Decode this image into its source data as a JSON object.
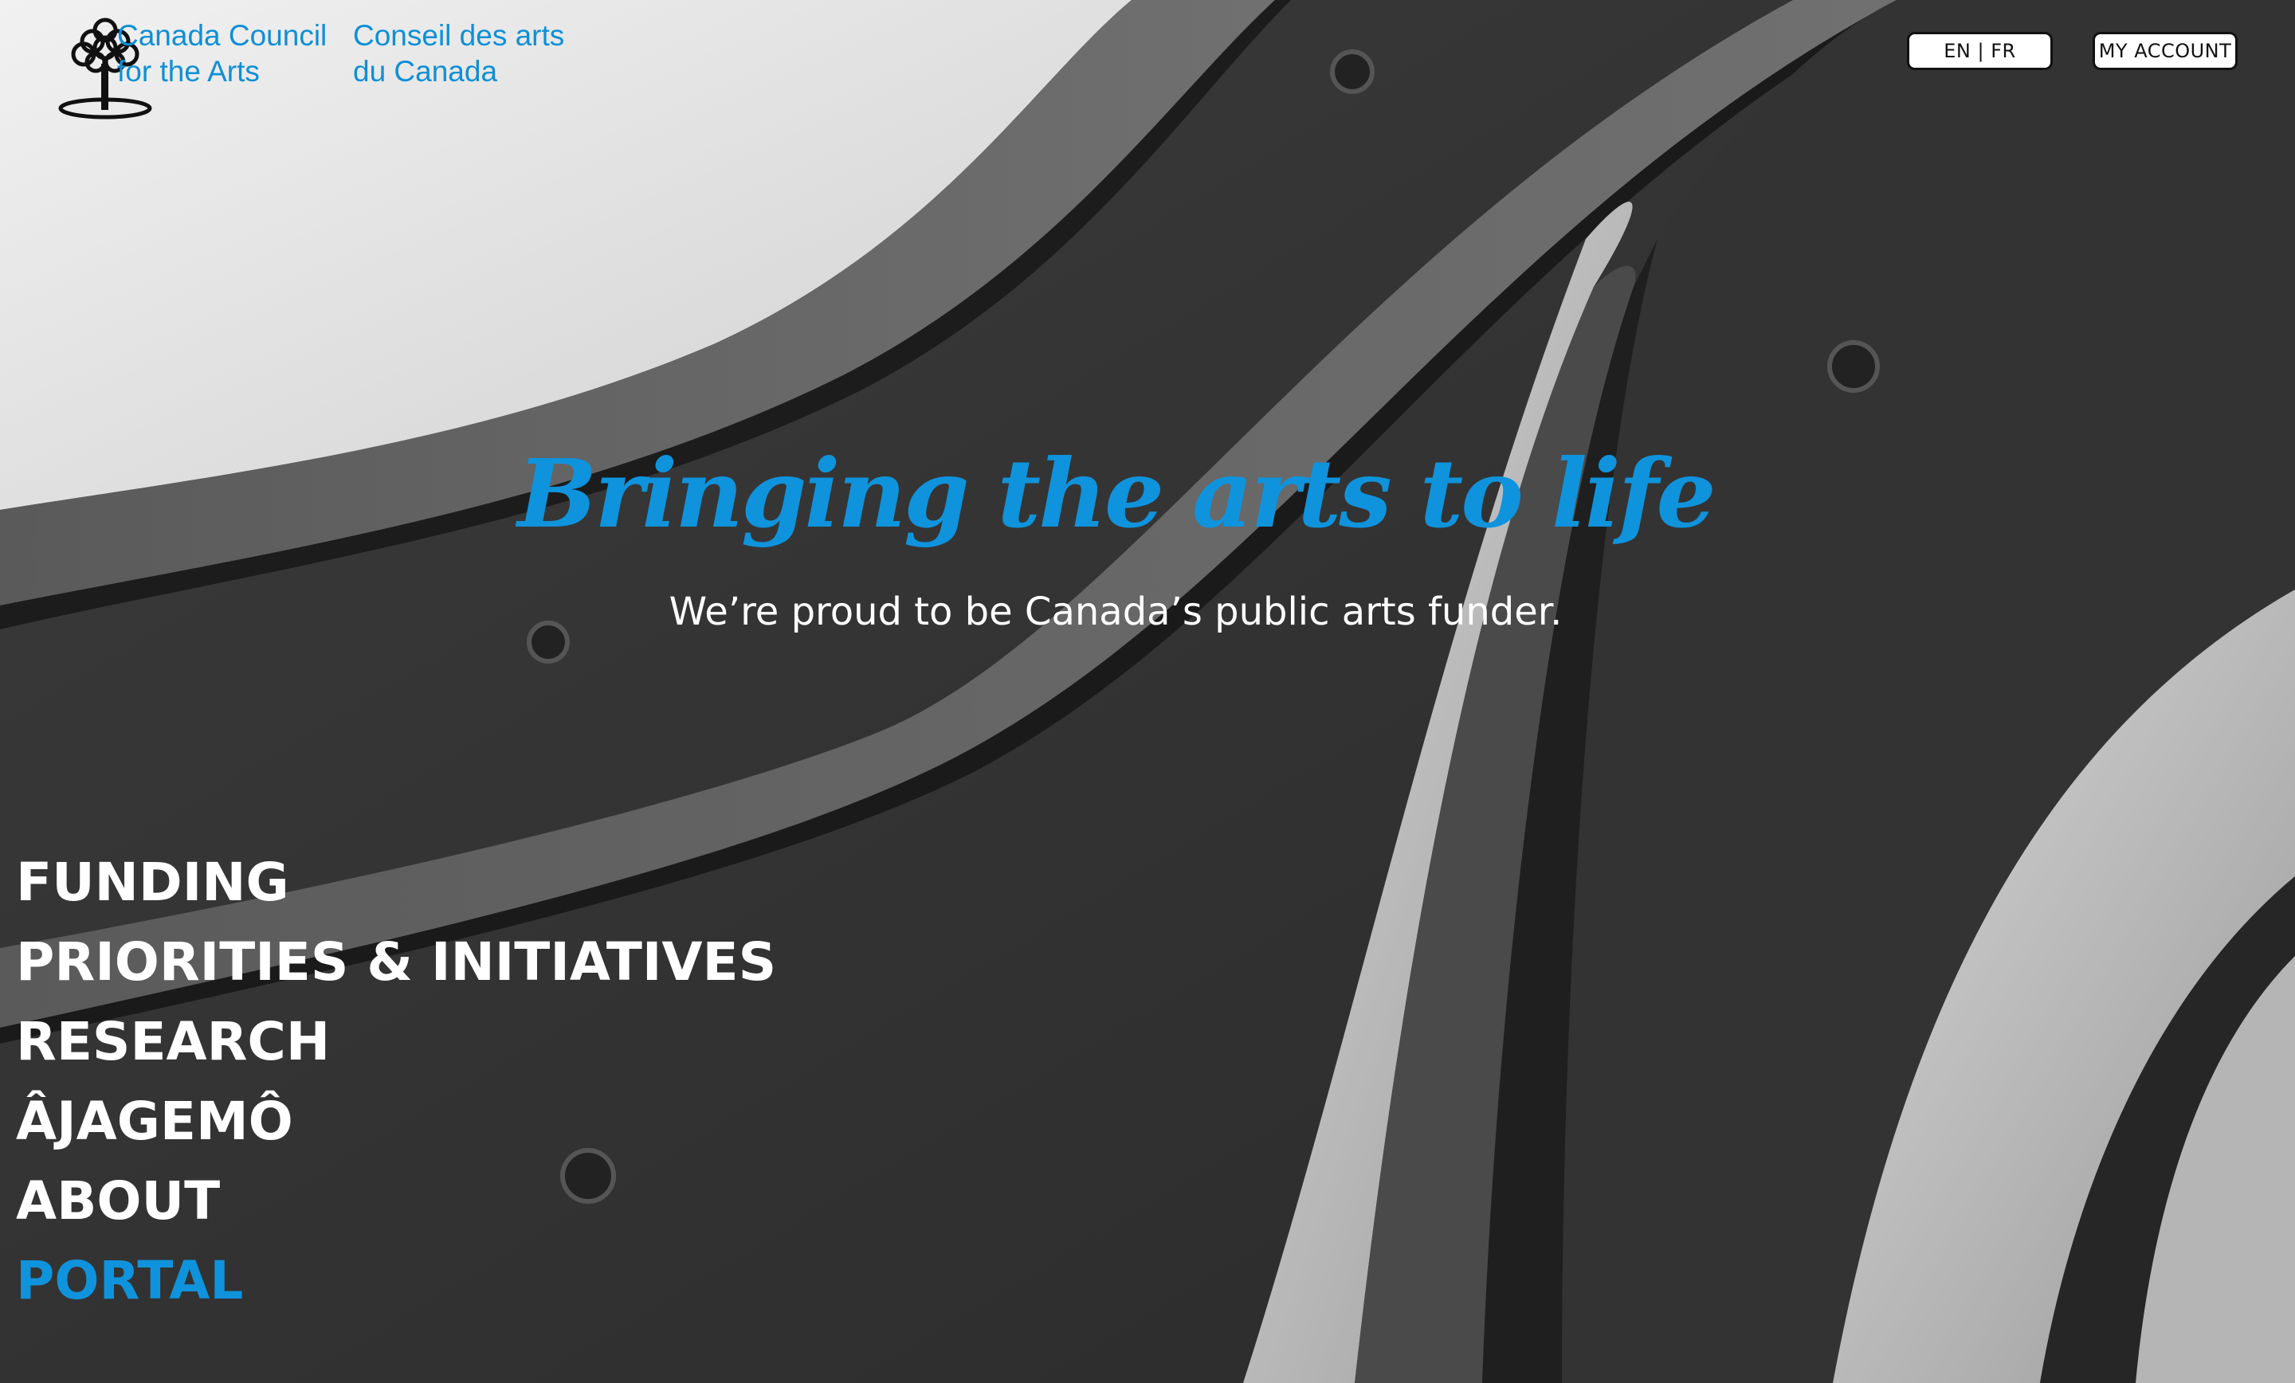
{
  "header": {
    "logo_en": [
      "Canada Council",
      "for the Arts"
    ],
    "logo_fr": [
      "Conseil des arts",
      "du Canada"
    ],
    "language_toggle": "EN | FR",
    "account_button": "MY ACCOUNT"
  },
  "hero": {
    "title": "Bringing the arts to life",
    "subtitle": "We’re proud to be Canada’s public arts funder."
  },
  "nav": {
    "items": [
      "FUNDING",
      "PRIORITIES & INITIATIVES",
      "RESEARCH",
      "ÂJAGEMÔ",
      "ABOUT",
      "PORTAL"
    ]
  },
  "colors": {
    "brand_blue": "#0f93dc",
    "button_bg": "#ffffff",
    "text_light": "#ffffff"
  }
}
